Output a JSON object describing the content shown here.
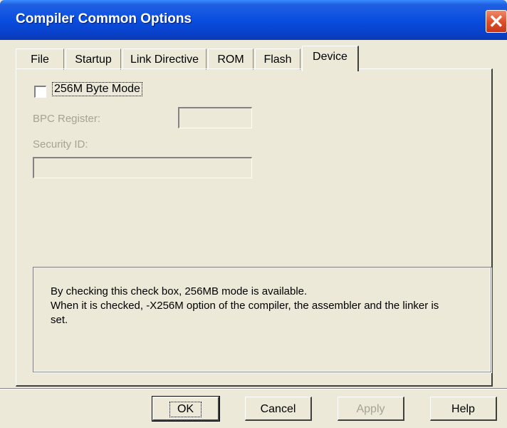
{
  "window": {
    "title": "Compiler Common Options",
    "close_symbol": "✕"
  },
  "tabs": [
    {
      "label": "File"
    },
    {
      "label": "Startup"
    },
    {
      "label": "Link Directive"
    },
    {
      "label": "ROM"
    },
    {
      "label": "Flash"
    },
    {
      "label": "Device",
      "active": true
    }
  ],
  "device": {
    "mode_checkbox_label": "256M Byte Mode",
    "mode_checked": false,
    "bpc_label": "BPC Register:",
    "bpc_value": "",
    "security_label": "Security ID:",
    "security_value": ""
  },
  "description": {
    "line1": "By checking this check box, 256MB mode is available.",
    "line2": "When it is checked, -X256M option of the compiler, the assembler and the linker is",
    "line3": "set."
  },
  "buttons": {
    "ok": "OK",
    "cancel": "Cancel",
    "apply": "Apply",
    "help": "Help"
  },
  "icons": {
    "close": "close-icon"
  }
}
